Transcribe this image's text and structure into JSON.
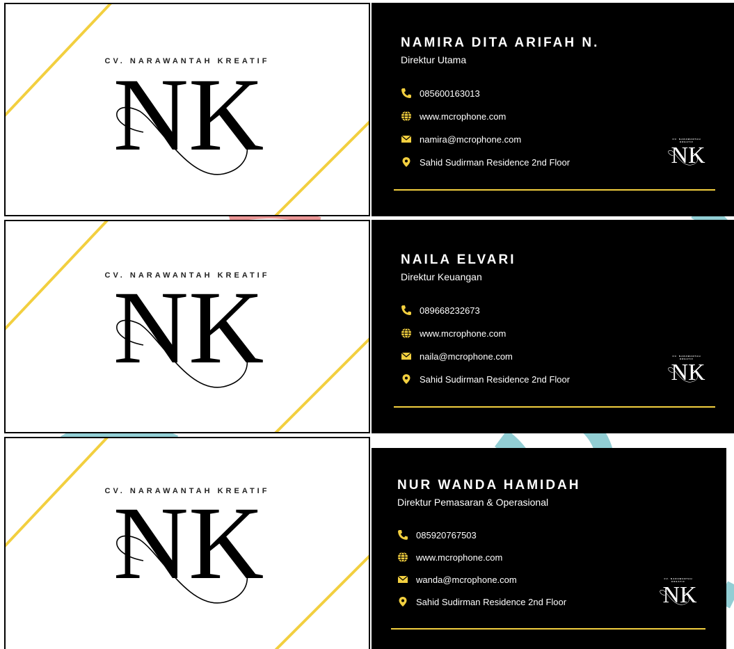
{
  "colors": {
    "accent_gold": "#f2cf3f",
    "card_back": "#000000",
    "card_front": "#ffffff",
    "swoosh_teal": "#7fc6cc",
    "swoosh_pink": "#e88a8a"
  },
  "brand": {
    "company": "CV. NARAWANTAH KREATIF",
    "monogram": "NK"
  },
  "cards": [
    {
      "name": "NAMIRA DITA ARIFAH N.",
      "title": "Direktur Utama",
      "phone": "085600163013",
      "website": "www.mcrophone.com",
      "email": "namira@mcrophone.com",
      "address": "Sahid Sudirman Residence 2nd Floor",
      "icons": [
        "phone-icon",
        "globe-icon",
        "mail-icon",
        "location-pin-icon"
      ]
    },
    {
      "name": "NAILA ELVARI",
      "title": "Direktur Keuangan",
      "phone": "089668232673",
      "website": "www.mcrophone.com",
      "email": "naila@mcrophone.com",
      "address": "Sahid Sudirman Residence 2nd Floor",
      "icons": [
        "phone-icon",
        "globe-icon",
        "mail-icon",
        "location-pin-icon"
      ]
    },
    {
      "name": "NUR WANDA HAMIDAH",
      "title": "Direktur Pemasaran & Operasional",
      "phone": "085920767503",
      "website": "www.mcrophone.com",
      "email": "wanda@mcrophone.com",
      "address": "Sahid Sudirman Residence 2nd Floor",
      "icons": [
        "phone-icon",
        "globe-icon",
        "mail-icon",
        "location-pin-icon"
      ]
    }
  ]
}
